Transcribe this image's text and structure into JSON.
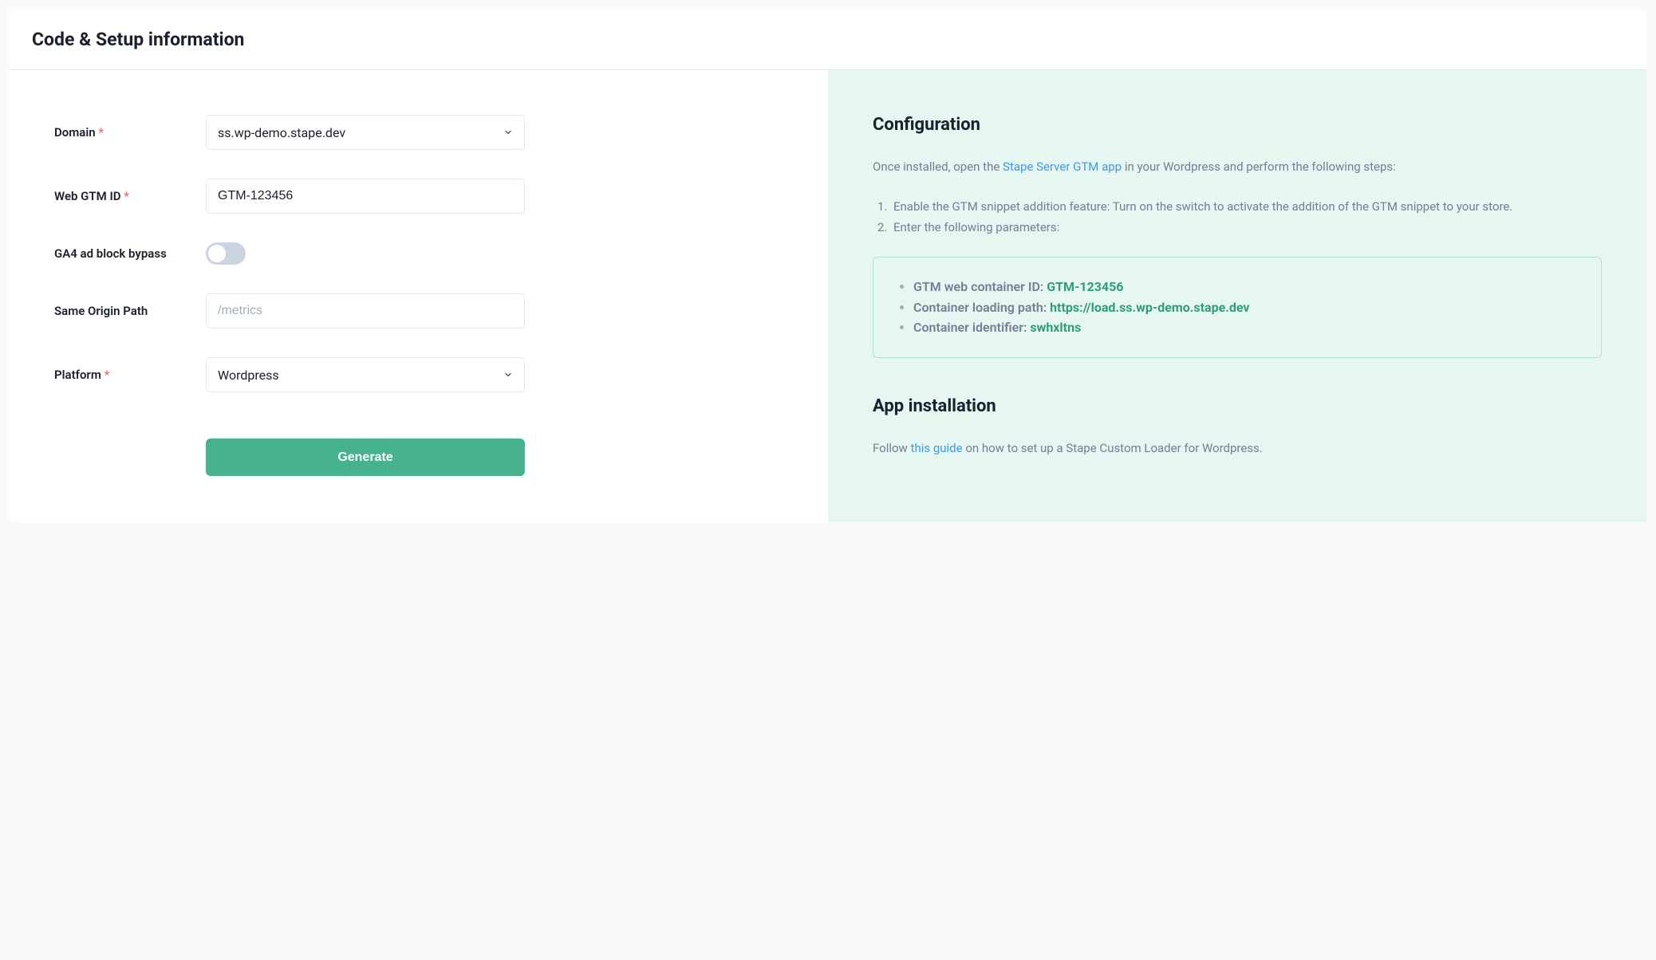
{
  "header": {
    "title": "Code & Setup information"
  },
  "form": {
    "domain": {
      "label": "Domain",
      "value": "ss.wp-demo.stape.dev"
    },
    "gtm_id": {
      "label": "Web GTM ID",
      "value": "GTM-123456"
    },
    "ga4_bypass": {
      "label": "GA4 ad block bypass"
    },
    "same_origin": {
      "label": "Same Origin Path",
      "placeholder": "/metrics"
    },
    "platform": {
      "label": "Platform",
      "value": "Wordpress"
    },
    "generate_button": "Generate"
  },
  "config": {
    "title": "Configuration",
    "intro_before": "Once installed, open the ",
    "intro_link": "Stape Server GTM app",
    "intro_after": " in your Wordpress and perform the following steps:",
    "step1": "Enable the GTM snippet addition feature: Turn on the switch to activate the addition of the GTM snippet to your store.",
    "step2": "Enter the following parameters:",
    "params": {
      "gtm_label": "GTM web container ID: ",
      "gtm_value": "GTM-123456",
      "path_label": "Container loading path: ",
      "path_value": "https://load.ss.wp-demo.stape.dev",
      "identifier_label": "Container identifier: ",
      "identifier_value": "swhxltns"
    }
  },
  "install": {
    "title": "App installation",
    "text_before": "Follow ",
    "link": "this guide",
    "text_after": " on how to set up a Stape Custom Loader for Wordpress."
  }
}
